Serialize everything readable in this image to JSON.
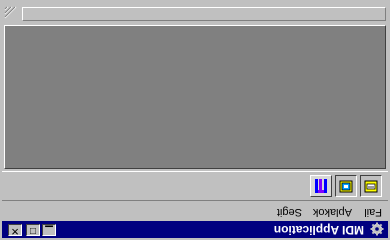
{
  "window": {
    "title": "MDI Application",
    "controls": {
      "minimize": "▁",
      "maximize": "□",
      "close": "✕"
    }
  },
  "menu": {
    "items": [
      "Fail",
      "Aplakok",
      "Segit"
    ]
  },
  "toolbar": {
    "buttons": [
      {
        "name": "new-document",
        "icon": "new-document-icon",
        "state": "raised"
      },
      {
        "name": "open-document",
        "icon": "open-document-icon",
        "state": "raised"
      },
      {
        "name": "tile",
        "icon": "tile-windows-icon",
        "state": "pressed"
      }
    ]
  },
  "colors": {
    "titlebar": "#000080",
    "face": "#c0c0c0",
    "client": "#808080"
  }
}
